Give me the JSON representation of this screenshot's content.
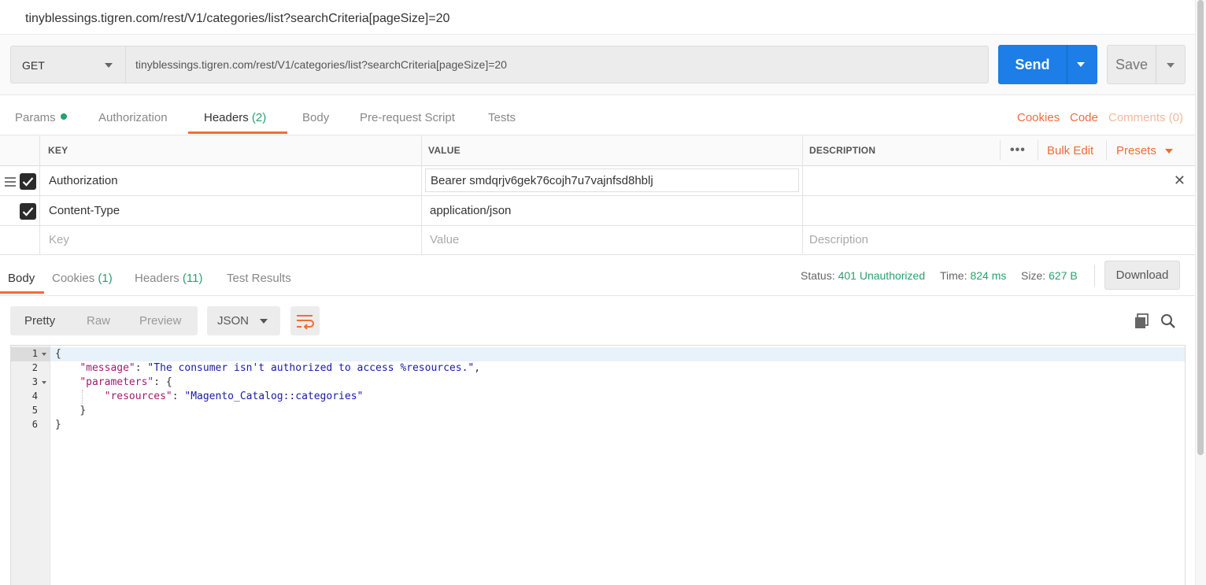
{
  "window": {
    "title": "tinyblessings.tigren.com/rest/V1/categories/list?searchCriteria[pageSize]=20"
  },
  "request": {
    "method": "GET",
    "url": "tinyblessings.tigren.com/rest/V1/categories/list?searchCriteria[pageSize]=20",
    "send_label": "Send",
    "save_label": "Save"
  },
  "request_tabs": {
    "params": "Params",
    "authorization": "Authorization",
    "headers": "Headers",
    "headers_count": "(2)",
    "body": "Body",
    "prerequest": "Pre-request Script",
    "tests": "Tests",
    "cookies": "Cookies",
    "code": "Code",
    "comments": "Comments (0)"
  },
  "headers_table": {
    "columns": {
      "key": "KEY",
      "value": "VALUE",
      "description": "DESCRIPTION"
    },
    "more": "•••",
    "bulk_edit": "Bulk Edit",
    "presets": "Presets",
    "rows": [
      {
        "key": "Authorization",
        "value": "Bearer smdqrjv6gek76cojh7u7vajnfsd8hblj",
        "description": ""
      },
      {
        "key": "Content-Type",
        "value": "application/json",
        "description": ""
      }
    ],
    "placeholder": {
      "key": "Key",
      "value": "Value",
      "description": "Description"
    }
  },
  "response_tabs": {
    "body": "Body",
    "cookies": "Cookies",
    "cookies_count": "(1)",
    "headers": "Headers",
    "headers_count": "(11)",
    "test_results": "Test Results"
  },
  "response_meta": {
    "status_label": "Status:",
    "status_value": "401 Unauthorized",
    "time_label": "Time:",
    "time_value": "824 ms",
    "size_label": "Size:",
    "size_value": "627 B",
    "download": "Download"
  },
  "response_toolbar": {
    "pretty": "Pretty",
    "raw": "Raw",
    "preview": "Preview",
    "format": "JSON"
  },
  "code": {
    "line_numbers": [
      "1",
      "2",
      "3",
      "4",
      "5",
      "6"
    ],
    "l1": "{",
    "l2_key": "\"message\"",
    "l2_sep": ": ",
    "l2_val": "\"The consumer isn't authorized to access %resources.\"",
    "l2_end": ",",
    "l3_key": "\"parameters\"",
    "l3_rest": ": {",
    "l4_key": "\"resources\"",
    "l4_sep": ": ",
    "l4_val": "\"Magento_Catalog::categories\"",
    "l5": "}",
    "l6": "}"
  },
  "colors": {
    "accent": "#f26b3a",
    "send": "#1c7ee6",
    "success": "#2aa06d"
  }
}
